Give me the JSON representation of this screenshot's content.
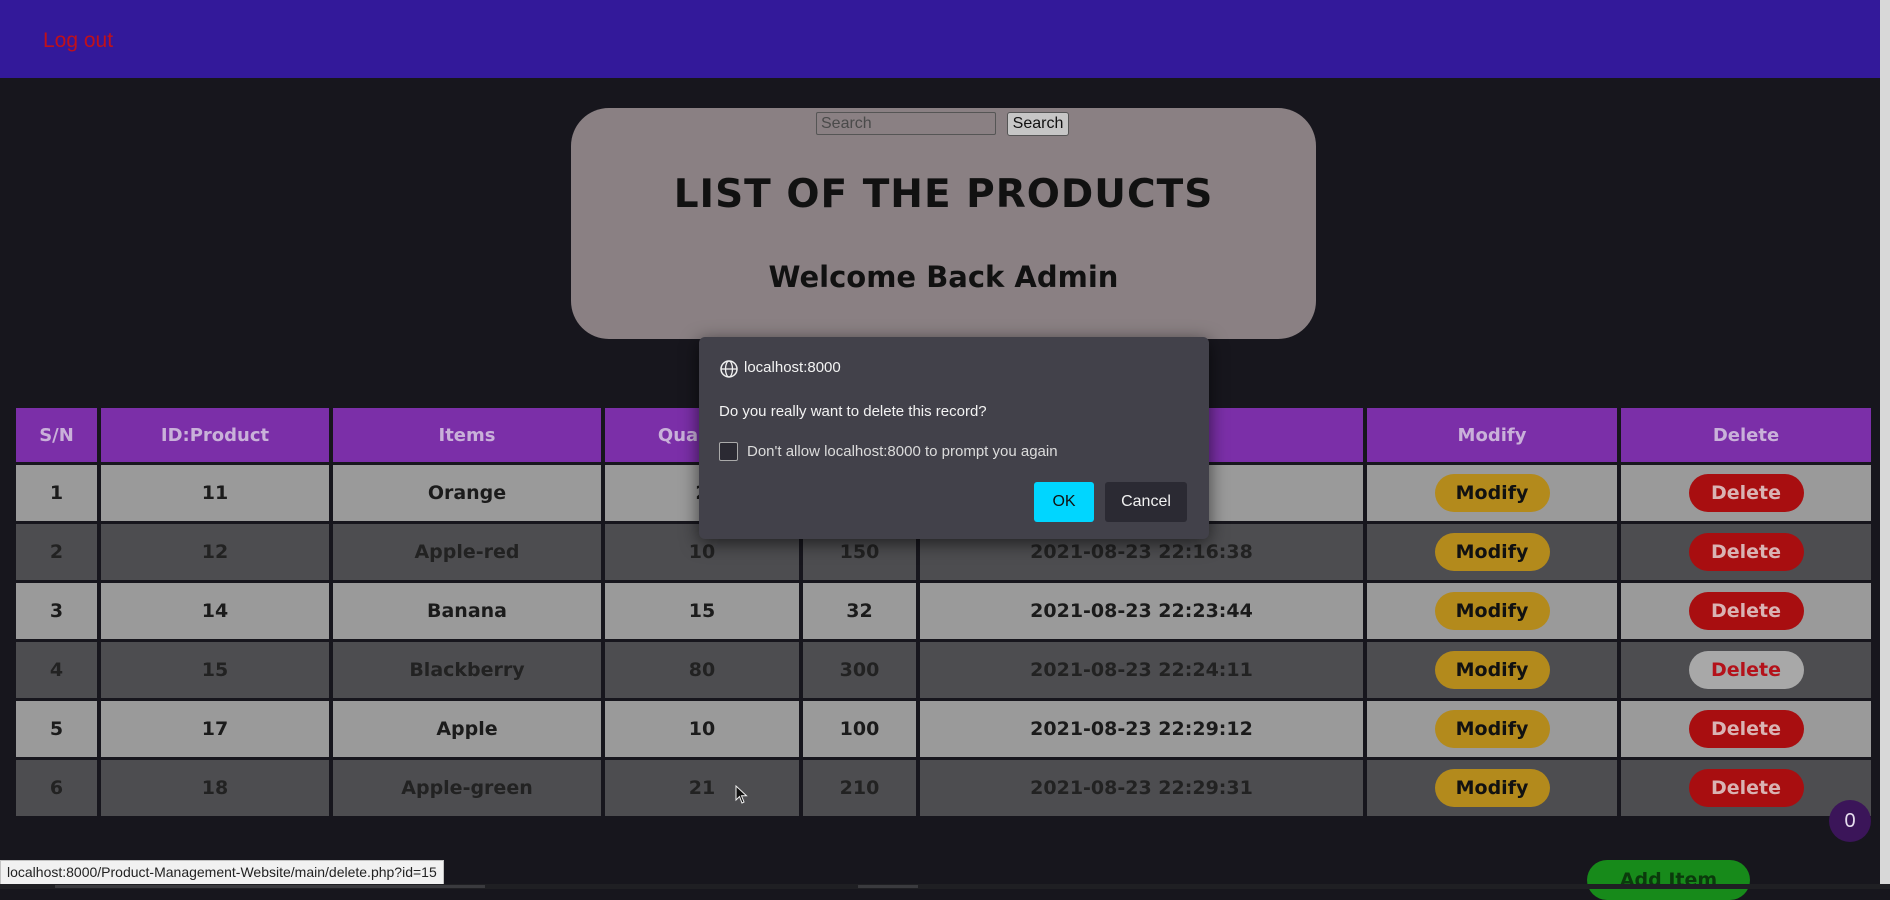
{
  "header": {
    "logout_label": "Log out"
  },
  "search": {
    "placeholder": "Search",
    "button_label": "Search"
  },
  "hero": {
    "title": "LIST OF THE PRODUCTS",
    "subtitle": "Welcome Back Admin"
  },
  "table": {
    "columns": [
      "S/N",
      "ID:Product",
      "Items",
      "Quantity",
      "",
      "",
      "Modify",
      "Delete"
    ],
    "rows": [
      {
        "sn": "1",
        "id": "11",
        "item": "Orange",
        "qty": "2",
        "col5": "",
        "date": "1:36",
        "modify": "Modify",
        "delete": "Delete"
      },
      {
        "sn": "2",
        "id": "12",
        "item": "Apple-red",
        "qty": "10",
        "col5": "150",
        "date": "2021-08-23 22:16:38",
        "modify": "Modify",
        "delete": "Delete"
      },
      {
        "sn": "3",
        "id": "14",
        "item": "Banana",
        "qty": "15",
        "col5": "32",
        "date": "2021-08-23 22:23:44",
        "modify": "Modify",
        "delete": "Delete"
      },
      {
        "sn": "4",
        "id": "15",
        "item": "Blackberry",
        "qty": "80",
        "col5": "300",
        "date": "2021-08-23 22:24:11",
        "modify": "Modify",
        "delete": "Delete"
      },
      {
        "sn": "5",
        "id": "17",
        "item": "Apple",
        "qty": "10",
        "col5": "100",
        "date": "2021-08-23 22:29:12",
        "modify": "Modify",
        "delete": "Delete"
      },
      {
        "sn": "6",
        "id": "18",
        "item": "Apple-green",
        "qty": "21",
        "col5": "210",
        "date": "2021-08-23 22:29:31",
        "modify": "Modify",
        "delete": "Delete"
      }
    ]
  },
  "dialog": {
    "origin": "localhost:8000",
    "message": "Do you really want to delete this record?",
    "checkbox_label": "Don't allow localhost:8000 to prompt you again",
    "ok_label": "OK",
    "cancel_label": "Cancel"
  },
  "status_bar": {
    "url": "localhost:8000/Product-Management-Website/main/delete.php?id=15"
  },
  "add_item": {
    "label": "Add Item"
  },
  "cart": {
    "count": "0"
  },
  "colors": {
    "header_bg": "#33199a",
    "accent_purple": "#7b2fa8",
    "modify_gold": "#b38a1c",
    "delete_red": "#a80e10",
    "ok_cyan": "#00d6ff",
    "add_green": "#178a1a"
  },
  "icons": {
    "dialog_origin": "globe-icon",
    "pointer": "cursor-icon"
  }
}
